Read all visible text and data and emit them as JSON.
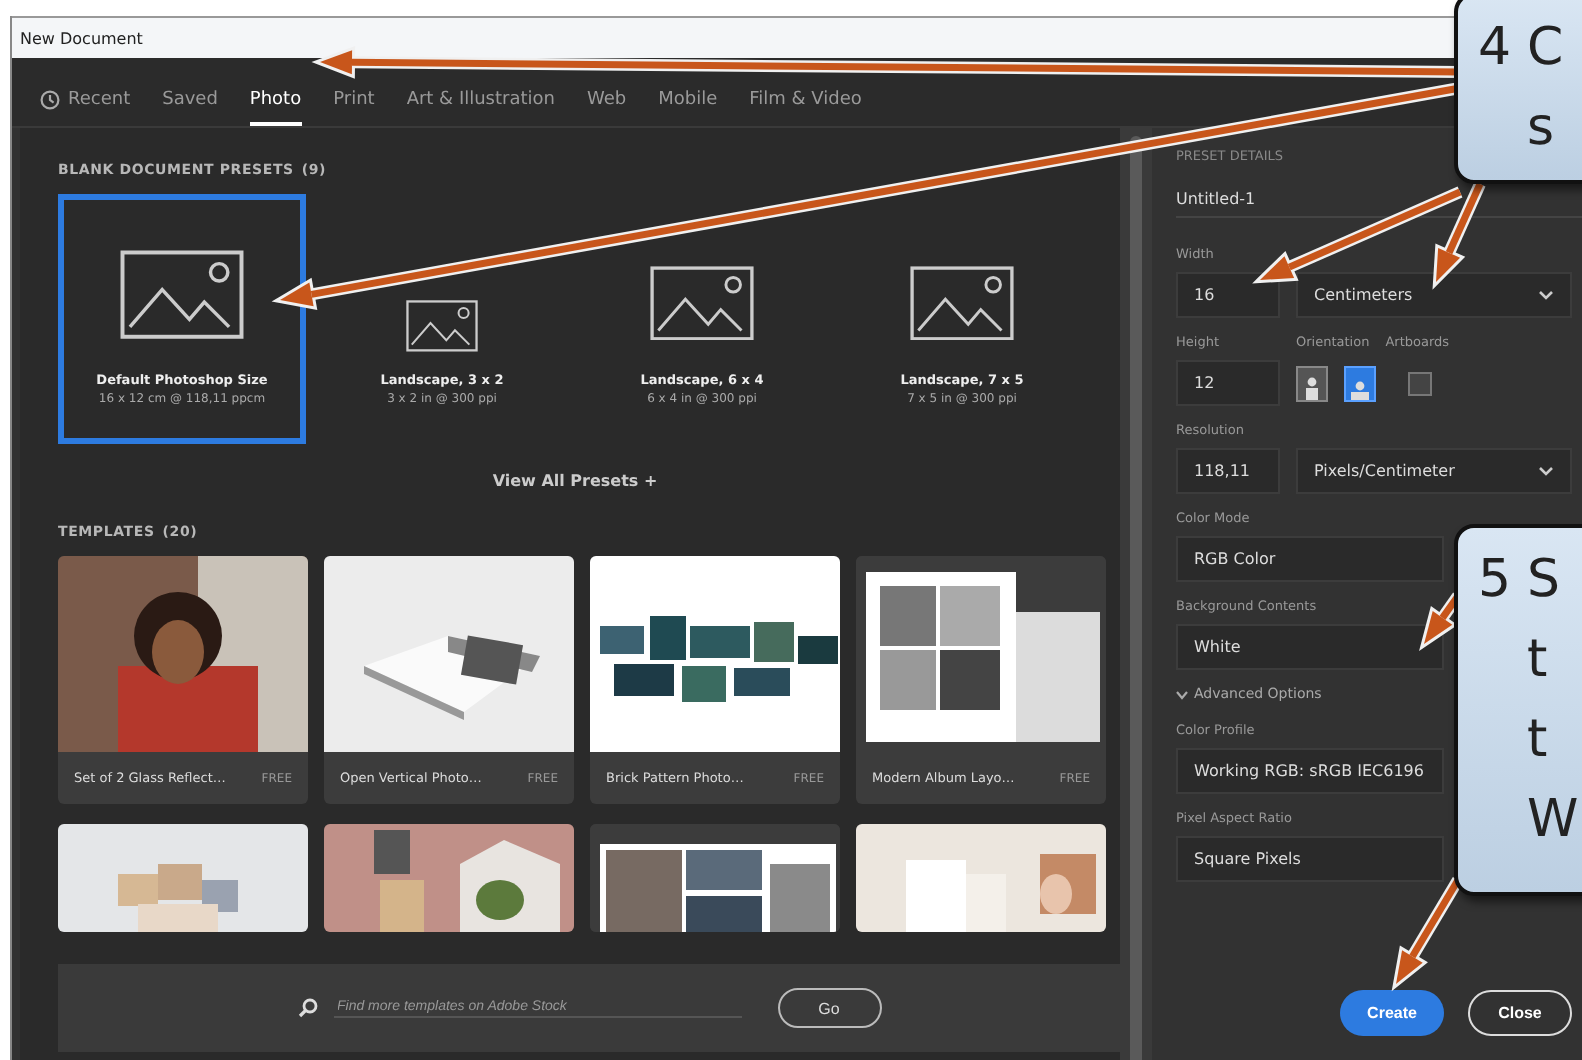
{
  "window": {
    "title": "New Document"
  },
  "tabs": [
    {
      "label": "Recent",
      "kind": "history",
      "selected": false
    },
    {
      "label": "Saved",
      "kind": "plain",
      "selected": false
    },
    {
      "label": "Photo",
      "kind": "plain",
      "selected": true
    },
    {
      "label": "Print",
      "kind": "plain",
      "selected": false
    },
    {
      "label": "Art & Illustration",
      "kind": "plain",
      "selected": false
    },
    {
      "label": "Web",
      "kind": "plain",
      "selected": false
    },
    {
      "label": "Mobile",
      "kind": "plain",
      "selected": false
    },
    {
      "label": "Film & Video",
      "kind": "plain",
      "selected": false
    }
  ],
  "presets": {
    "heading": "BLANK DOCUMENT PRESETS",
    "count": "(9)",
    "view_all": "View All Presets +",
    "items": [
      {
        "name": "Default Photoshop Size",
        "details": "16 x 12 cm @ 118,11 ppcm",
        "selected": true
      },
      {
        "name": "Landscape, 3 x 2",
        "details": "3 x 2 in @ 300 ppi",
        "selected": false
      },
      {
        "name": "Landscape, 6 x 4",
        "details": "6 x 4 in @ 300 ppi",
        "selected": false
      },
      {
        "name": "Landscape, 7 x 5",
        "details": "7 x 5 in @ 300 ppi",
        "selected": false
      }
    ]
  },
  "templates": {
    "heading": "TEMPLATES",
    "count": "(20)",
    "items": [
      {
        "name": "Set of 2 Glass Reflect…",
        "badge": "FREE"
      },
      {
        "name": "Open Vertical Photo…",
        "badge": "FREE"
      },
      {
        "name": "Brick Pattern Photo…",
        "badge": "FREE"
      },
      {
        "name": "Modern Album Layo…",
        "badge": "FREE"
      },
      {
        "kind": "picture"
      },
      {
        "kind": "picture"
      },
      {
        "kind": "picture"
      },
      {
        "kind": "picture"
      }
    ]
  },
  "search": {
    "placeholder": "Find more templates on Adobe Stock",
    "button": "Go"
  },
  "details": {
    "heading": "PRESET DETAILS",
    "name": "Untitled-1",
    "width": {
      "label": "Width",
      "value": "16",
      "unit": "Centimeters"
    },
    "height": {
      "label": "Height",
      "value": "12"
    },
    "orientation": {
      "label": "Orientation",
      "options": [
        {
          "kind": "portrait",
          "selected": false
        },
        {
          "kind": "landscape",
          "selected": true
        }
      ]
    },
    "artboards": {
      "label": "Artboards",
      "checked": false
    },
    "resolution": {
      "label": "Resolution",
      "value": "118,11",
      "unit": "Pixels/Centimeter"
    },
    "fields": [
      {
        "label": "Color Mode",
        "value": "RGB Color"
      },
      {
        "label": "Background Contents",
        "value": "White"
      }
    ],
    "advanced": {
      "label": "Advanced Options",
      "expanded": true
    },
    "advanced_fields": [
      {
        "label": "Color Profile",
        "value": "Working RGB: sRGB IEC6196"
      },
      {
        "label": "Pixel Aspect Ratio",
        "value": "Square Pixels"
      }
    ]
  },
  "buttons": [
    {
      "label": "Create",
      "kind": "primary"
    },
    {
      "label": "Close",
      "kind": "secondary"
    }
  ],
  "callouts": [
    {
      "number": "4",
      "lines": [
        "C",
        "s"
      ]
    },
    {
      "number": "5",
      "lines": [
        "S",
        "t",
        "t",
        "W"
      ]
    }
  ]
}
